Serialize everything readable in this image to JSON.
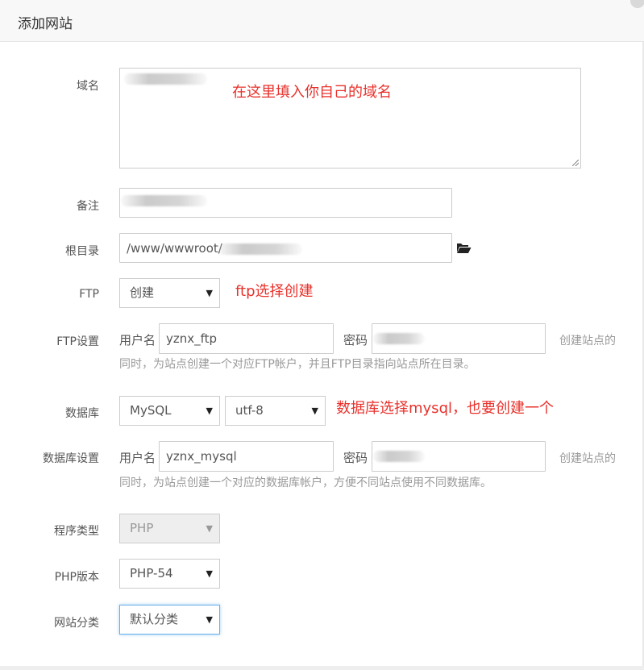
{
  "dialog": {
    "title": "添加网站"
  },
  "fields": {
    "domain": {
      "label": "域名",
      "value": ""
    },
    "remark": {
      "label": "备注",
      "value": ""
    },
    "root": {
      "label": "根目录",
      "value": "/www/wwwroot/"
    },
    "ftp": {
      "label": "FTP",
      "selected": "创建"
    },
    "ftp_settings": {
      "label": "FTP设置",
      "username_label": "用户名",
      "username_value": "yznx_ftp",
      "password_label": "密码",
      "password_value": "",
      "hint_suffix": "创建站点的",
      "hint_line2": "同时，为站点创建一个对应FTP帐户，并且FTP目录指向站点所在目录。"
    },
    "database": {
      "label": "数据库",
      "db_selected": "MySQL",
      "charset_selected": "utf-8"
    },
    "db_settings": {
      "label": "数据库设置",
      "username_label": "用户名",
      "username_value": "yznx_mysql",
      "password_label": "密码",
      "password_value": "",
      "hint_suffix": "创建站点的",
      "hint_line2": "同时，为站点创建一个对应的数据库帐户，方便不同站点使用不同数据库。"
    },
    "program_type": {
      "label": "程序类型",
      "selected": "PHP"
    },
    "php_version": {
      "label": "PHP版本",
      "selected": "PHP-54"
    },
    "category": {
      "label": "网站分类",
      "selected": "默认分类"
    }
  },
  "annotations": {
    "domain_note": "在这里填入你自己的域名",
    "ftp_note": "ftp选择创建",
    "db_note": "数据库选择mysql，也要创建一个"
  },
  "colors": {
    "annotation": "#e8322c",
    "focus": "#66afe9"
  },
  "icons": {
    "root_browse": "folder-open-icon",
    "select_arrow": "caret-down-icon"
  }
}
